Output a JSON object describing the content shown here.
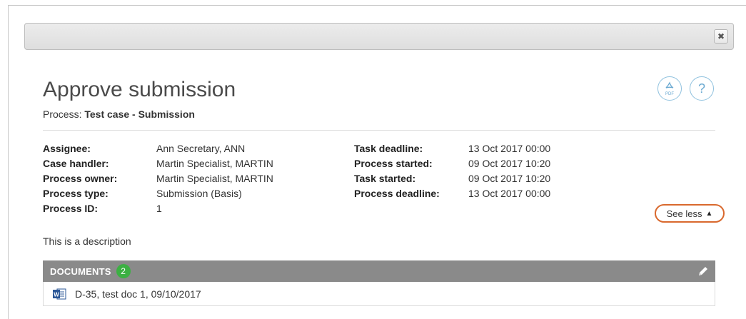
{
  "dialog": {
    "close_label": "✖"
  },
  "task": {
    "title": "Approve submission",
    "process_label": "Process:",
    "process_value": "Test case - Submission"
  },
  "icons": {
    "pdf_text": "PDF",
    "help_text": "?"
  },
  "details_left": [
    {
      "label": "Assignee:",
      "value": "Ann Secretary, ANN"
    },
    {
      "label": "Case handler:",
      "value": "Martin Specialist, MARTIN"
    },
    {
      "label": "Process owner:",
      "value": "Martin Specialist, MARTIN"
    },
    {
      "label": "Process type:",
      "value": "Submission (Basis)"
    },
    {
      "label": "Process ID:",
      "value": "1"
    }
  ],
  "details_right": [
    {
      "label": "Task deadline:",
      "value": "13 Oct 2017 00:00"
    },
    {
      "label": "Process started:",
      "value": "09 Oct 2017 10:20"
    },
    {
      "label": "Task started:",
      "value": "09 Oct 2017 10:20"
    },
    {
      "label": "Process deadline:",
      "value": "13 Oct 2017 00:00"
    }
  ],
  "see_less": {
    "label": "See less",
    "arrow": "▲",
    "highlight_color": "#d9692e"
  },
  "description": "This is a description",
  "documents": {
    "title": "DOCUMENTS",
    "count": "2",
    "badge_color": "#3cb043",
    "bar_color": "#8a8a8a",
    "items": [
      {
        "icon": "word-doc-icon",
        "text": "D-35, test doc 1, 09/10/2017"
      }
    ]
  }
}
